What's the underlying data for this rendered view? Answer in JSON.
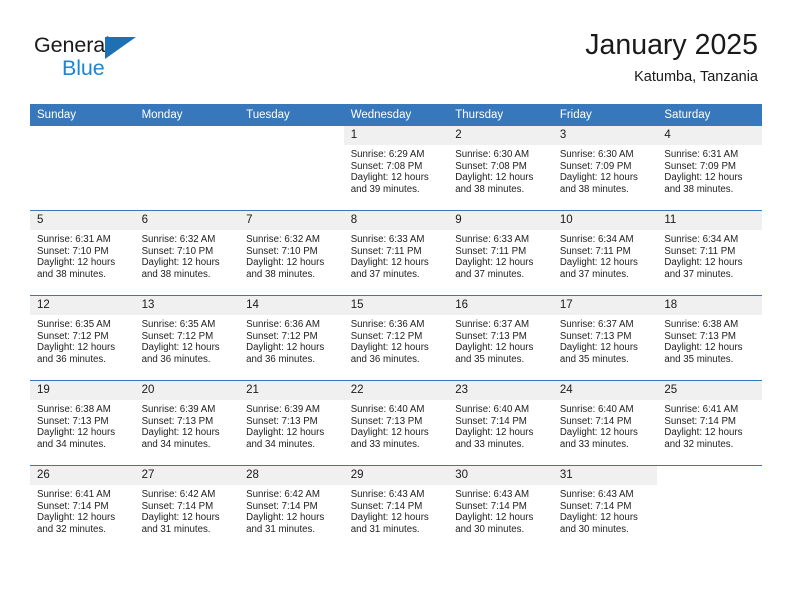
{
  "brand": {
    "name_part1": "General",
    "name_part2": "Blue",
    "logo_icon": "triangle-logo-icon"
  },
  "header": {
    "title": "January 2025",
    "subtitle": "Katumba, Tanzania"
  },
  "calendar": {
    "weekday_headers": [
      "Sunday",
      "Monday",
      "Tuesday",
      "Wednesday",
      "Thursday",
      "Friday",
      "Saturday"
    ],
    "colors": {
      "header_background": "#3778bc",
      "header_text": "#ffffff",
      "daynum_background": "#f0f0f0",
      "row_divider": "#3778bc",
      "brand_blue": "#1c86d4",
      "logo_blue": "#1f6fb5"
    },
    "weeks": [
      [
        {
          "day": "",
          "sunrise": "",
          "sunset": "",
          "daylight_line1": "",
          "daylight_line2": ""
        },
        {
          "day": "",
          "sunrise": "",
          "sunset": "",
          "daylight_line1": "",
          "daylight_line2": ""
        },
        {
          "day": "",
          "sunrise": "",
          "sunset": "",
          "daylight_line1": "",
          "daylight_line2": ""
        },
        {
          "day": "1",
          "sunrise": "Sunrise: 6:29 AM",
          "sunset": "Sunset: 7:08 PM",
          "daylight_line1": "Daylight: 12 hours",
          "daylight_line2": "and 39 minutes."
        },
        {
          "day": "2",
          "sunrise": "Sunrise: 6:30 AM",
          "sunset": "Sunset: 7:08 PM",
          "daylight_line1": "Daylight: 12 hours",
          "daylight_line2": "and 38 minutes."
        },
        {
          "day": "3",
          "sunrise": "Sunrise: 6:30 AM",
          "sunset": "Sunset: 7:09 PM",
          "daylight_line1": "Daylight: 12 hours",
          "daylight_line2": "and 38 minutes."
        },
        {
          "day": "4",
          "sunrise": "Sunrise: 6:31 AM",
          "sunset": "Sunset: 7:09 PM",
          "daylight_line1": "Daylight: 12 hours",
          "daylight_line2": "and 38 minutes."
        }
      ],
      [
        {
          "day": "5",
          "sunrise": "Sunrise: 6:31 AM",
          "sunset": "Sunset: 7:10 PM",
          "daylight_line1": "Daylight: 12 hours",
          "daylight_line2": "and 38 minutes."
        },
        {
          "day": "6",
          "sunrise": "Sunrise: 6:32 AM",
          "sunset": "Sunset: 7:10 PM",
          "daylight_line1": "Daylight: 12 hours",
          "daylight_line2": "and 38 minutes."
        },
        {
          "day": "7",
          "sunrise": "Sunrise: 6:32 AM",
          "sunset": "Sunset: 7:10 PM",
          "daylight_line1": "Daylight: 12 hours",
          "daylight_line2": "and 38 minutes."
        },
        {
          "day": "8",
          "sunrise": "Sunrise: 6:33 AM",
          "sunset": "Sunset: 7:11 PM",
          "daylight_line1": "Daylight: 12 hours",
          "daylight_line2": "and 37 minutes."
        },
        {
          "day": "9",
          "sunrise": "Sunrise: 6:33 AM",
          "sunset": "Sunset: 7:11 PM",
          "daylight_line1": "Daylight: 12 hours",
          "daylight_line2": "and 37 minutes."
        },
        {
          "day": "10",
          "sunrise": "Sunrise: 6:34 AM",
          "sunset": "Sunset: 7:11 PM",
          "daylight_line1": "Daylight: 12 hours",
          "daylight_line2": "and 37 minutes."
        },
        {
          "day": "11",
          "sunrise": "Sunrise: 6:34 AM",
          "sunset": "Sunset: 7:11 PM",
          "daylight_line1": "Daylight: 12 hours",
          "daylight_line2": "and 37 minutes."
        }
      ],
      [
        {
          "day": "12",
          "sunrise": "Sunrise: 6:35 AM",
          "sunset": "Sunset: 7:12 PM",
          "daylight_line1": "Daylight: 12 hours",
          "daylight_line2": "and 36 minutes."
        },
        {
          "day": "13",
          "sunrise": "Sunrise: 6:35 AM",
          "sunset": "Sunset: 7:12 PM",
          "daylight_line1": "Daylight: 12 hours",
          "daylight_line2": "and 36 minutes."
        },
        {
          "day": "14",
          "sunrise": "Sunrise: 6:36 AM",
          "sunset": "Sunset: 7:12 PM",
          "daylight_line1": "Daylight: 12 hours",
          "daylight_line2": "and 36 minutes."
        },
        {
          "day": "15",
          "sunrise": "Sunrise: 6:36 AM",
          "sunset": "Sunset: 7:12 PM",
          "daylight_line1": "Daylight: 12 hours",
          "daylight_line2": "and 36 minutes."
        },
        {
          "day": "16",
          "sunrise": "Sunrise: 6:37 AM",
          "sunset": "Sunset: 7:13 PM",
          "daylight_line1": "Daylight: 12 hours",
          "daylight_line2": "and 35 minutes."
        },
        {
          "day": "17",
          "sunrise": "Sunrise: 6:37 AM",
          "sunset": "Sunset: 7:13 PM",
          "daylight_line1": "Daylight: 12 hours",
          "daylight_line2": "and 35 minutes."
        },
        {
          "day": "18",
          "sunrise": "Sunrise: 6:38 AM",
          "sunset": "Sunset: 7:13 PM",
          "daylight_line1": "Daylight: 12 hours",
          "daylight_line2": "and 35 minutes."
        }
      ],
      [
        {
          "day": "19",
          "sunrise": "Sunrise: 6:38 AM",
          "sunset": "Sunset: 7:13 PM",
          "daylight_line1": "Daylight: 12 hours",
          "daylight_line2": "and 34 minutes."
        },
        {
          "day": "20",
          "sunrise": "Sunrise: 6:39 AM",
          "sunset": "Sunset: 7:13 PM",
          "daylight_line1": "Daylight: 12 hours",
          "daylight_line2": "and 34 minutes."
        },
        {
          "day": "21",
          "sunrise": "Sunrise: 6:39 AM",
          "sunset": "Sunset: 7:13 PM",
          "daylight_line1": "Daylight: 12 hours",
          "daylight_line2": "and 34 minutes."
        },
        {
          "day": "22",
          "sunrise": "Sunrise: 6:40 AM",
          "sunset": "Sunset: 7:13 PM",
          "daylight_line1": "Daylight: 12 hours",
          "daylight_line2": "and 33 minutes."
        },
        {
          "day": "23",
          "sunrise": "Sunrise: 6:40 AM",
          "sunset": "Sunset: 7:14 PM",
          "daylight_line1": "Daylight: 12 hours",
          "daylight_line2": "and 33 minutes."
        },
        {
          "day": "24",
          "sunrise": "Sunrise: 6:40 AM",
          "sunset": "Sunset: 7:14 PM",
          "daylight_line1": "Daylight: 12 hours",
          "daylight_line2": "and 33 minutes."
        },
        {
          "day": "25",
          "sunrise": "Sunrise: 6:41 AM",
          "sunset": "Sunset: 7:14 PM",
          "daylight_line1": "Daylight: 12 hours",
          "daylight_line2": "and 32 minutes."
        }
      ],
      [
        {
          "day": "26",
          "sunrise": "Sunrise: 6:41 AM",
          "sunset": "Sunset: 7:14 PM",
          "daylight_line1": "Daylight: 12 hours",
          "daylight_line2": "and 32 minutes."
        },
        {
          "day": "27",
          "sunrise": "Sunrise: 6:42 AM",
          "sunset": "Sunset: 7:14 PM",
          "daylight_line1": "Daylight: 12 hours",
          "daylight_line2": "and 31 minutes."
        },
        {
          "day": "28",
          "sunrise": "Sunrise: 6:42 AM",
          "sunset": "Sunset: 7:14 PM",
          "daylight_line1": "Daylight: 12 hours",
          "daylight_line2": "and 31 minutes."
        },
        {
          "day": "29",
          "sunrise": "Sunrise: 6:43 AM",
          "sunset": "Sunset: 7:14 PM",
          "daylight_line1": "Daylight: 12 hours",
          "daylight_line2": "and 31 minutes."
        },
        {
          "day": "30",
          "sunrise": "Sunrise: 6:43 AM",
          "sunset": "Sunset: 7:14 PM",
          "daylight_line1": "Daylight: 12 hours",
          "daylight_line2": "and 30 minutes."
        },
        {
          "day": "31",
          "sunrise": "Sunrise: 6:43 AM",
          "sunset": "Sunset: 7:14 PM",
          "daylight_line1": "Daylight: 12 hours",
          "daylight_line2": "and 30 minutes."
        },
        {
          "day": "",
          "sunrise": "",
          "sunset": "",
          "daylight_line1": "",
          "daylight_line2": ""
        }
      ]
    ]
  }
}
